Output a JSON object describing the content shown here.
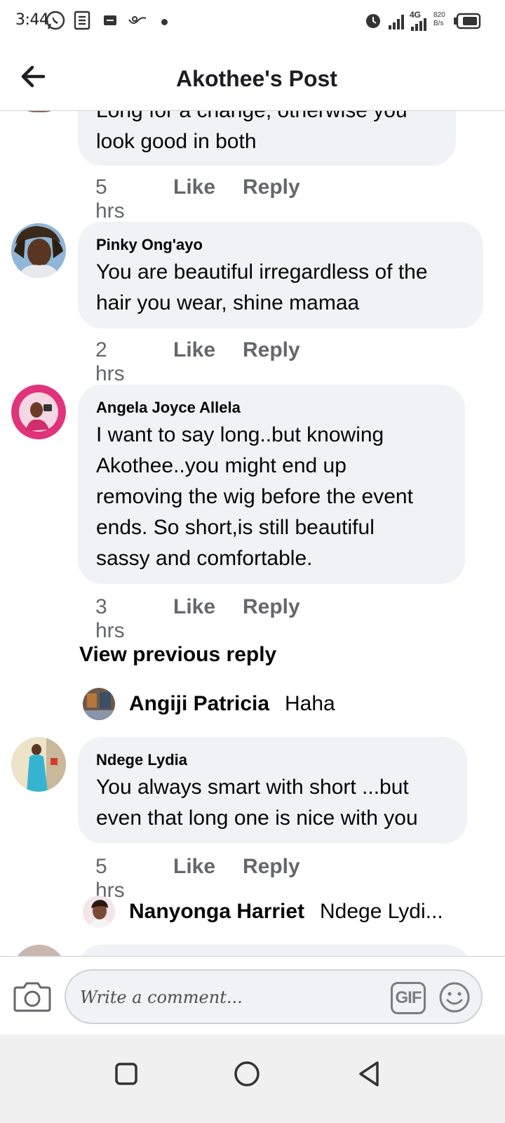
{
  "status_bar": {
    "time": "3:44",
    "network": "4G",
    "speed": "820 B/s"
  },
  "header": {
    "title": "Akothee's Post",
    "back_icon": "arrow-left-icon"
  },
  "comments": [
    {
      "author": "",
      "text_lines": [
        "Long for a change, otherwise you",
        "look good in both"
      ],
      "time": "5 hrs",
      "like_label": "Like",
      "reply_label": "Reply"
    },
    {
      "author": "Pinky Ong'ayo",
      "text_lines": [
        "You are beautiful irregardless of the",
        "hair you wear, shine mamaa"
      ],
      "time": "2 hrs",
      "like_label": "Like",
      "reply_label": "Reply"
    },
    {
      "author": "Angela Joyce Allela",
      "text_lines": [
        "I want to say long..but knowing",
        "Akothee..you might end up",
        "removing the wig before the event",
        "ends. So short,is still beautiful",
        "sassy and comfortable."
      ],
      "time": "3 hrs",
      "like_label": "Like",
      "reply_label": "Reply",
      "view_previous": "View previous reply",
      "reply": {
        "author": "Angiji Patricia",
        "text": "Haha"
      }
    },
    {
      "author": "Ndege Lydia",
      "text_lines": [
        "You always smart with short ...but",
        "even that long one is nice with you"
      ],
      "time": "5 hrs",
      "like_label": "Like",
      "reply_label": "Reply",
      "reply": {
        "author": "Nanyonga Harriet",
        "text": "Ndege Lydi..."
      }
    }
  ],
  "composer": {
    "placeholder": "Write a comment...",
    "gif_label": "GIF",
    "camera_icon": "camera-icon",
    "emoji_icon": "emoji-icon"
  },
  "navbar": {
    "items": [
      "recents-square-icon",
      "home-circle-icon",
      "back-triangle-icon"
    ]
  },
  "colors": {
    "bubble": "#f0f2f5",
    "meta_text": "#65676b",
    "text": "#050505"
  }
}
